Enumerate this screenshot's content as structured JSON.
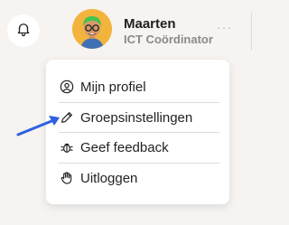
{
  "header": {
    "notification_icon": "bell-icon",
    "user": {
      "name": "Maarten",
      "role": "ICT Coördinator",
      "avatar": "avatar-illustration"
    },
    "more_label": "···"
  },
  "menu": {
    "items": [
      {
        "label": "Mijn profiel",
        "icon": "user-circle-icon"
      },
      {
        "label": "Groepsinstellingen",
        "icon": "pencil-icon"
      },
      {
        "label": "Geef feedback",
        "icon": "bug-icon"
      },
      {
        "label": "Uitloggen",
        "icon": "hand-wave-icon"
      }
    ]
  },
  "colors": {
    "background": "#f6f3f1",
    "avatar_bg": "#f2b43d",
    "arrow": "#2f5fe0"
  }
}
